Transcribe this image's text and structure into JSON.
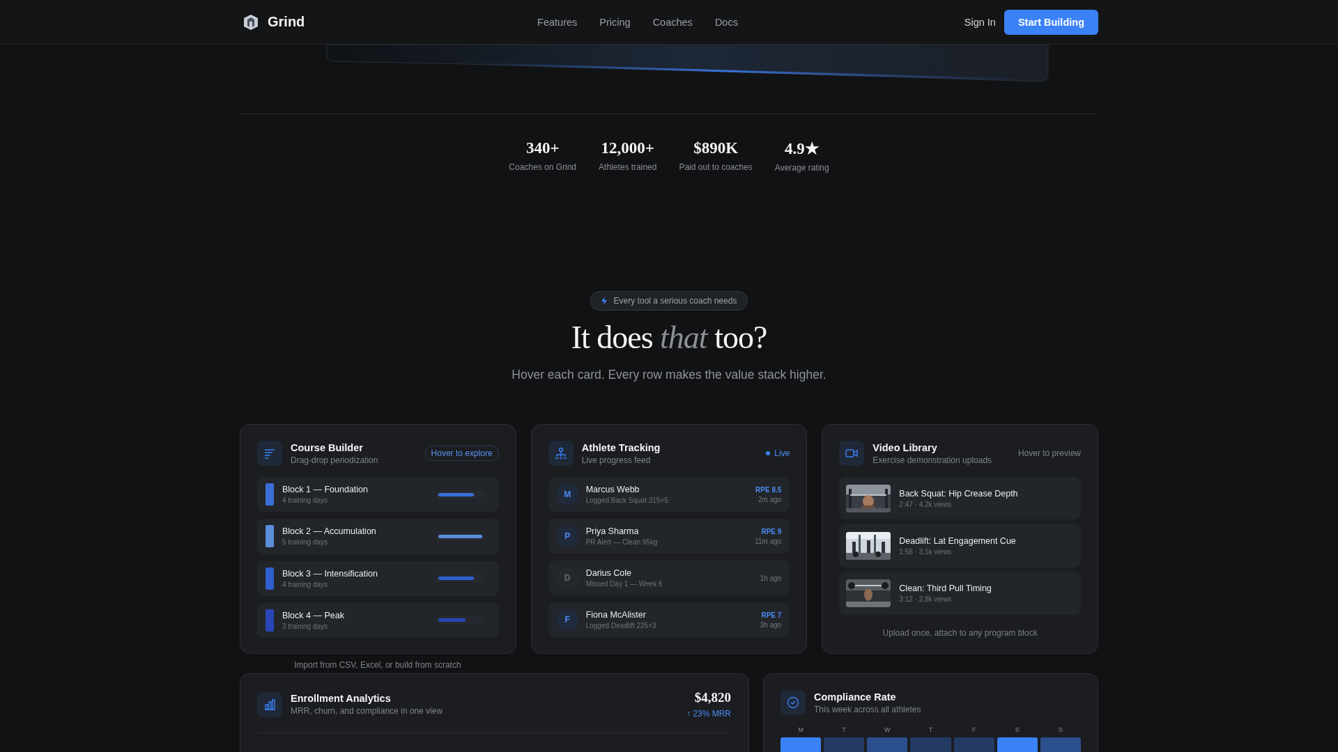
{
  "nav": {
    "brand": "Grind",
    "links": [
      "Features",
      "Pricing",
      "Coaches",
      "Docs"
    ],
    "sign_in": "Sign In",
    "cta": "Start Building"
  },
  "stats": [
    {
      "value": "340+",
      "label": "Coaches on Grind"
    },
    {
      "value": "12,000+",
      "label": "Athletes trained"
    },
    {
      "value": "$890K",
      "label": "Paid out to coaches"
    },
    {
      "value": "4.9★",
      "label": "Average rating"
    }
  ],
  "section": {
    "badge": "Every tool a serious coach needs",
    "heading": "It does *that* too?",
    "subtitle": "Hover each card. Every row makes the value stack higher."
  },
  "course_builder": {
    "title": "Course Builder",
    "subtitle": "Drag-drop periodization",
    "tag": "Hover to explore",
    "caption": "Import from CSV, Excel, or build from scratch",
    "blocks": [
      {
        "name": "Block 1 — Foundation",
        "days": "4 training days",
        "color": "#3a6fd8",
        "level": 0.82
      },
      {
        "name": "Block 2 — Accumulation",
        "days": "5 training days",
        "color": "#5b8fdc",
        "level": 1.0
      },
      {
        "name": "Block 3 — Intensification",
        "days": "4 training days",
        "color": "#2f5fd0",
        "level": 0.82
      },
      {
        "name": "Block 4 — Peak",
        "days": "3 training days",
        "color": "#2846b8",
        "level": 0.62
      }
    ]
  },
  "athlete_tracking": {
    "title": "Athlete Tracking",
    "subtitle": "Live progress feed",
    "status": "Live",
    "athletes": [
      {
        "initial": "M",
        "name": "Marcus Webb",
        "activity": "Logged Back Squat 315×5",
        "rpe": "RPE 8.5",
        "time": "2m ago",
        "inactive": false
      },
      {
        "initial": "P",
        "name": "Priya Sharma",
        "activity": "PR Alert — Clean 95kg",
        "rpe": "RPE 9",
        "time": "11m ago",
        "inactive": false
      },
      {
        "initial": "D",
        "name": "Darius Cole",
        "activity": "Missed Day 1 — Week 6",
        "time": "1h ago",
        "inactive": true
      },
      {
        "initial": "F",
        "name": "Fiona McAlister",
        "activity": "Logged Deadlift 225×3",
        "rpe": "RPE 7",
        "time": "3h ago",
        "inactive": false
      }
    ]
  },
  "video_library": {
    "title": "Video Library",
    "subtitle": "Exercise demonstration uploads",
    "tag": "Hover to preview",
    "footer": "Upload once, attach to any program block",
    "videos": [
      {
        "title": "Back Squat: Hip Crease Depth",
        "meta": "2:47 · 4.2k views"
      },
      {
        "title": "Deadlift: Lat Engagement Cue",
        "meta": "1:58 · 3.1k views"
      },
      {
        "title": "Clean: Third Pull Timing",
        "meta": "3:12 · 2.8k views"
      }
    ]
  },
  "enrollment_analytics": {
    "title": "Enrollment Analytics",
    "subtitle": "MRR, churn, and compliance in one view",
    "value": "$4,820",
    "change": "↑ 23% MRR"
  },
  "compliance_rate": {
    "title": "Compliance Rate",
    "subtitle": "This week across all athletes",
    "days": [
      {
        "label": "M",
        "color": "#3b82f6"
      },
      {
        "label": "T",
        "color": "#233a63"
      },
      {
        "label": "W",
        "color": "#2c4f8e"
      },
      {
        "label": "T",
        "color": "#233a63"
      },
      {
        "label": "F",
        "color": "#233a63"
      },
      {
        "label": "S",
        "color": "#3b82f6"
      },
      {
        "label": "S",
        "color": "#2c4f8e"
      }
    ]
  }
}
